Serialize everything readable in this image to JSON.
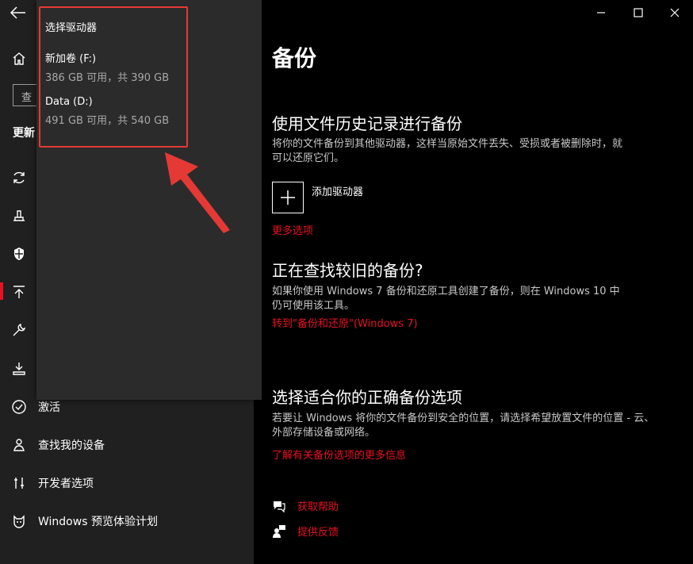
{
  "nav": {
    "search_placeholder": "查",
    "section_heading": "更新",
    "items": [
      {
        "label": "激活",
        "icon": "check-circle-icon"
      },
      {
        "label": "查找我的设备",
        "icon": "person-pin-icon"
      },
      {
        "label": "开发者选项",
        "icon": "developer-tools-icon"
      },
      {
        "label": "Windows 预览体验计划",
        "icon": "cat-icon"
      }
    ]
  },
  "flyout": {
    "title": "选择驱动器",
    "drives": [
      {
        "name": "新加卷 (F:)",
        "capacity": "386 GB 可用，共 390 GB"
      },
      {
        "name": "Data (D:)",
        "capacity": "491 GB 可用，共 540 GB"
      }
    ]
  },
  "main": {
    "title": "备份",
    "file_history": {
      "heading": "使用文件历史记录进行备份",
      "description": "将你的文件备份到其他驱动器，这样当原始文件丢失、受损或者被删除时，就可以还原它们。",
      "add_drive": "添加驱动器",
      "more_options": "更多选项"
    },
    "older_backup": {
      "heading": "正在查找较旧的备份?",
      "description": "如果你使用 Windows 7 备份和还原工具创建了备份，则在 Windows 10 中仍可使用该工具。",
      "link": "转到\"备份和还原\"(Windows 7)"
    },
    "right_option": {
      "heading": "选择适合你的正确备份选项",
      "description": "若要让 Windows 将你的文件备份到安全的位置，请选择希望放置文件的位置 - 云、外部存储设备或网络。",
      "link": "了解有关备份选项的更多信息"
    },
    "help": {
      "get_help": "获取帮助",
      "feedback": "提供反馈"
    }
  },
  "colors": {
    "accent": "#e81123",
    "annotation": "#e53935",
    "nav_bg": "#202020",
    "flyout_bg": "#2b2b2b"
  }
}
